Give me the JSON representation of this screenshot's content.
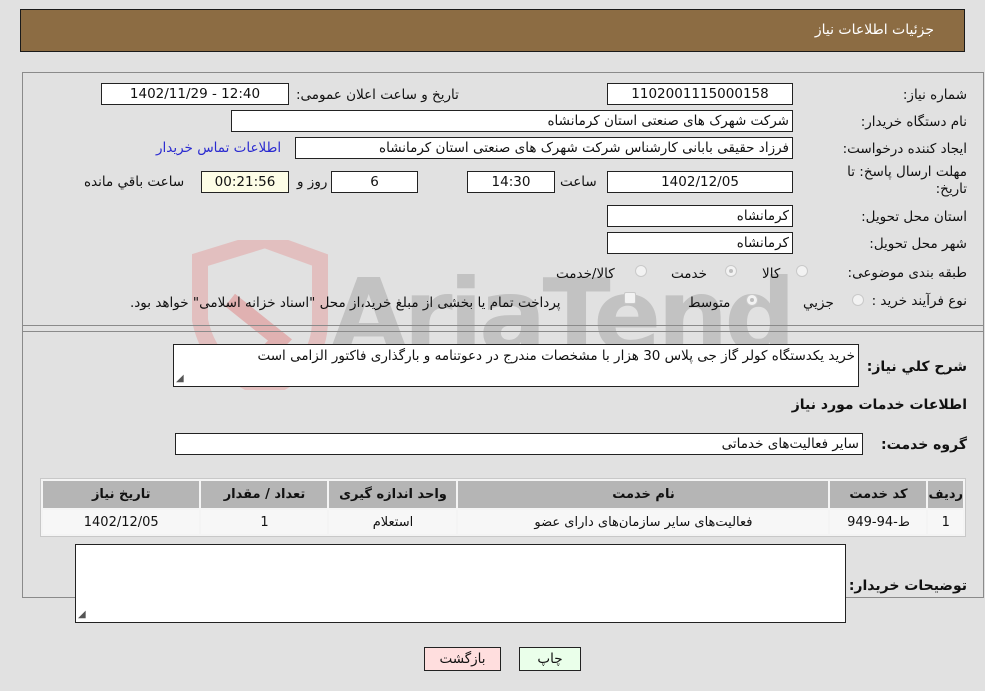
{
  "header": {
    "title": "جزئیات اطلاعات نیاز"
  },
  "fields": {
    "need_number_label": "شماره نیاز:",
    "need_number": "1102001115000158",
    "announce_label": "تاریخ و ساعت اعلان عمومی:",
    "announce_value": "1402/11/29 - 12:40",
    "buyer_org_label": "نام دستگاه خریدار:",
    "buyer_org": "شرکت شهرک های صنعتی استان کرمانشاه",
    "creator_label": "ایجاد کننده درخواست:",
    "creator": "فرزاد حقیقی بابانی کارشناس شرکت شهرک های صنعتی استان کرمانشاه",
    "buyer_contact_link": "اطلاعات تماس خریدار",
    "deadline_label": "مهلت ارسال پاسخ: تا تاریخ:",
    "deadline_date": "1402/12/05",
    "time_label": "ساعت",
    "deadline_time": "14:30",
    "days_value": "6",
    "days_label": "روز و",
    "remaining_time": "00:21:56",
    "remaining_label": "ساعت باقي مانده",
    "province_label": "استان محل تحویل:",
    "province": "کرمانشاه",
    "city_label": "شهر محل تحویل:",
    "city": "کرمانشاه",
    "category_label": "طبقه بندی موضوعی:",
    "category_options": [
      {
        "label": "کالا",
        "selected": false
      },
      {
        "label": "خدمت",
        "selected": true
      },
      {
        "label": "کالا/خدمت",
        "selected": false
      }
    ],
    "process_label": "نوع فرآیند خرید :",
    "process_options": [
      {
        "label": "جزيي",
        "selected": false
      },
      {
        "label": "متوسط",
        "selected": true
      }
    ],
    "treasury_checkbox_label": "پرداخت تمام یا بخشی از مبلغ خرید،از محل \"اسناد خزانه اسلامی\" خواهد بود.",
    "treasury_checked": false
  },
  "description": {
    "label": "شرح کلي نياز:",
    "value": "خرید یکدستگاه کولر گاز جی پلاس 30 هزار با مشخصات مندرج در دعوتنامه و بارگذاری فاکتور الزامی است"
  },
  "services_section": {
    "title": "اطلاعات خدمات مورد نياز",
    "group_label": "گروه خدمت:",
    "group_value": "سایر فعالیت‌های خدماتی"
  },
  "table": {
    "columns": [
      "رديف",
      "کد خدمت",
      "نام خدمت",
      "واحد اندازه گیری",
      "تعداد / مقدار",
      "تاریخ نیاز"
    ],
    "rows": [
      [
        "1",
        "ط-94-949",
        "فعالیت‌های سایر سازمان‌های دارای عضو",
        "استعلام",
        "1",
        "1402/12/05"
      ]
    ]
  },
  "buyer_notes": {
    "label": "توضیحات خریدار:",
    "value": ""
  },
  "buttons": {
    "print": "چاپ",
    "back": "بازگشت"
  },
  "watermark": {
    "text": "AriaTender.neT"
  },
  "colors": {
    "header_bg": "#8c6c43",
    "print_bg": "#eaffea",
    "back_bg": "#ffdede",
    "link": "#2a2ad0"
  }
}
